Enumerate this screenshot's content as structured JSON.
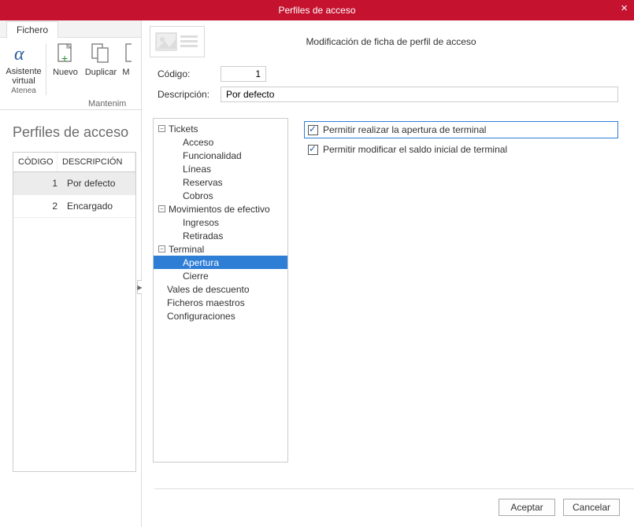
{
  "window": {
    "title": "Perfiles de acceso"
  },
  "dialog": {
    "title": "Modificación de ficha de perfil de acceso"
  },
  "tabs": {
    "fichero": "Fichero"
  },
  "ribbon": {
    "asistente": {
      "label": "Asistente virtual",
      "sub": "Atenea"
    },
    "nuevo": "Nuevo",
    "duplicar": "Duplicar",
    "m": "M",
    "group_label": "Mantenim"
  },
  "content": {
    "title": "Perfiles de acceso"
  },
  "grid": {
    "headers": {
      "codigo": "CÓDIGO",
      "descripcion": "DESCRIPCIÓN"
    },
    "rows": [
      {
        "codigo": "1",
        "descripcion": "Por defecto",
        "selected": true
      },
      {
        "codigo": "2",
        "descripcion": "Encargado",
        "selected": false
      }
    ]
  },
  "form": {
    "codigo_label": "Código:",
    "codigo_value": "1",
    "descripcion_label": "Descripción:",
    "descripcion_value": "Por defecto"
  },
  "tree": [
    {
      "label": "Tickets",
      "level": 1,
      "expandable": true,
      "icon": "−"
    },
    {
      "label": "Acceso",
      "level": 2
    },
    {
      "label": "Funcionalidad",
      "level": 2
    },
    {
      "label": "Líneas",
      "level": 2
    },
    {
      "label": "Reservas",
      "level": 2
    },
    {
      "label": "Cobros",
      "level": 2
    },
    {
      "label": "Movimientos de efectivo",
      "level": 1,
      "expandable": true,
      "icon": "−"
    },
    {
      "label": "Ingresos",
      "level": 2
    },
    {
      "label": "Retiradas",
      "level": 2
    },
    {
      "label": "Terminal",
      "level": 1,
      "expandable": true,
      "icon": "−"
    },
    {
      "label": "Apertura",
      "level": 2,
      "selected": true
    },
    {
      "label": "Cierre",
      "level": 2
    },
    {
      "label": "Vales de descuento",
      "level": 1
    },
    {
      "label": "Ficheros maestros",
      "level": 1
    },
    {
      "label": "Configuraciones",
      "level": 1
    }
  ],
  "permissions": [
    {
      "label": "Permitir realizar la apertura de terminal",
      "checked": true,
      "highlight": true
    },
    {
      "label": "Permitir modificar el saldo inicial de terminal",
      "checked": true,
      "highlight": false
    }
  ],
  "buttons": {
    "aceptar": "Aceptar",
    "cancelar": "Cancelar"
  }
}
